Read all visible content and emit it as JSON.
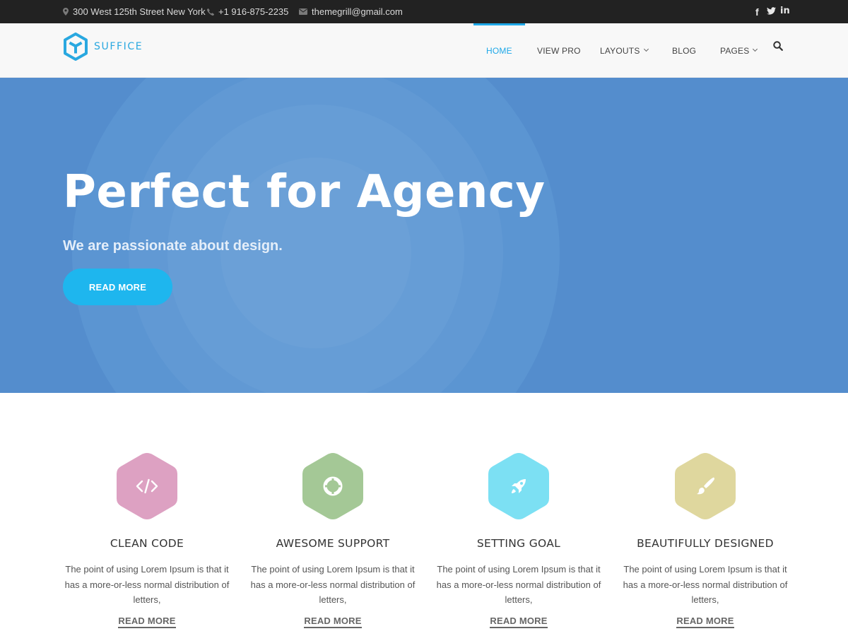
{
  "topbar": {
    "address": "300 West 125th Street New York",
    "phone": "+1 916-875-2235",
    "email": "themegrill@gmail.com",
    "social": [
      {
        "icon": "facebook-icon",
        "glyph": "f"
      },
      {
        "icon": "twitter-icon",
        "glyph": "🐦"
      },
      {
        "icon": "linkedin-icon",
        "glyph": "in"
      }
    ]
  },
  "header": {
    "logo_text": "SUFFICE",
    "nav": [
      {
        "label": "HOME",
        "active": true
      },
      {
        "label": "VIEW PRO"
      },
      {
        "label": "LAYOUTS",
        "has_dropdown": true
      },
      {
        "label": "BLOG"
      },
      {
        "label": "PAGES",
        "has_dropdown": true
      }
    ],
    "search_icon": "search-icon"
  },
  "hero": {
    "title": "Perfect for Agency",
    "subtitle": "We are passionate about design.",
    "button_label": "READ MORE"
  },
  "features": [
    {
      "title": "CLEAN CODE",
      "text": "The point of using Lorem Ipsum is that it has a more-or-less normal distribution of letters,",
      "link": "READ MORE",
      "icon": "code-icon",
      "color": "#dda1c2"
    },
    {
      "title": "AWESOME SUPPORT",
      "text": "The point of using Lorem Ipsum is that it has a more-or-less normal distribution of letters,",
      "link": "READ MORE",
      "icon": "life-ring-icon",
      "color": "#a4c896"
    },
    {
      "title": "SETTING GOAL",
      "text": "The point of using Lorem Ipsum is that it has a more-or-less normal distribution of letters,",
      "link": "READ MORE",
      "icon": "rocket-icon",
      "color": "#7ce0f3"
    },
    {
      "title": "BEAUTIFULLY DESIGNED",
      "text": "The point of using Lorem Ipsum is that it has a more-or-less normal distribution of letters,",
      "link": "READ MORE",
      "icon": "paint-brush-icon",
      "color": "#dfd79e"
    }
  ],
  "colors": {
    "accent": "#1ea8e8",
    "hero_bg": "#548dcd",
    "topbar_bg": "#222222",
    "button_bg": "#1eb6ee"
  }
}
